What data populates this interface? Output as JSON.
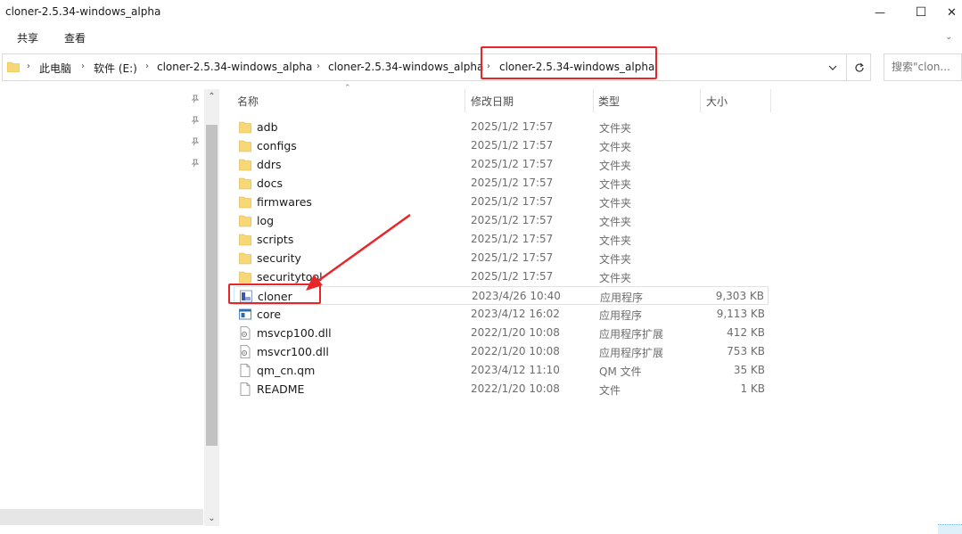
{
  "window": {
    "title": "cloner-2.5.34-windows_alpha",
    "minimize_glyph": "—",
    "maximize_glyph": "☐",
    "close_glyph": "✕"
  },
  "ribbon": {
    "tabs": [
      "共享",
      "查看"
    ]
  },
  "address": {
    "breadcrumbs": [
      "此电脑",
      "软件 (E:)",
      "cloner-2.5.34-windows_alpha",
      "cloner-2.5.34-windows_alpha",
      "cloner-2.5.34-windows_alpha"
    ]
  },
  "search": {
    "placeholder": "搜索\"clon..."
  },
  "columns": {
    "name": "名称",
    "date": "修改日期",
    "type": "类型",
    "size": "大小"
  },
  "files": [
    {
      "name": "adb",
      "date": "2025/1/2 17:57",
      "type": "文件夹",
      "size": "",
      "icon": "folder-icon"
    },
    {
      "name": "configs",
      "date": "2025/1/2 17:57",
      "type": "文件夹",
      "size": "",
      "icon": "folder-icon"
    },
    {
      "name": "ddrs",
      "date": "2025/1/2 17:57",
      "type": "文件夹",
      "size": "",
      "icon": "folder-icon"
    },
    {
      "name": "docs",
      "date": "2025/1/2 17:57",
      "type": "文件夹",
      "size": "",
      "icon": "folder-icon"
    },
    {
      "name": "firmwares",
      "date": "2025/1/2 17:57",
      "type": "文件夹",
      "size": "",
      "icon": "folder-icon"
    },
    {
      "name": "log",
      "date": "2025/1/2 17:57",
      "type": "文件夹",
      "size": "",
      "icon": "folder-icon"
    },
    {
      "name": "scripts",
      "date": "2025/1/2 17:57",
      "type": "文件夹",
      "size": "",
      "icon": "folder-icon"
    },
    {
      "name": "security",
      "date": "2025/1/2 17:57",
      "type": "文件夹",
      "size": "",
      "icon": "folder-icon"
    },
    {
      "name": "securitytool",
      "date": "2025/1/2 17:57",
      "type": "文件夹",
      "size": "",
      "icon": "folder-icon"
    },
    {
      "name": "cloner",
      "date": "2023/4/26 10:40",
      "type": "应用程序",
      "size": "9,303 KB",
      "icon": "app-icon",
      "selected": true
    },
    {
      "name": "core",
      "date": "2023/4/12 16:02",
      "type": "应用程序",
      "size": "9,113 KB",
      "icon": "window-app-icon"
    },
    {
      "name": "msvcp100.dll",
      "date": "2022/1/20 10:08",
      "type": "应用程序扩展",
      "size": "412 KB",
      "icon": "dll-icon"
    },
    {
      "name": "msvcr100.dll",
      "date": "2022/1/20 10:08",
      "type": "应用程序扩展",
      "size": "753 KB",
      "icon": "dll-icon"
    },
    {
      "name": "qm_cn.qm",
      "date": "2023/4/12 11:10",
      "type": "QM 文件",
      "size": "35 KB",
      "icon": "file-icon"
    },
    {
      "name": "README",
      "date": "2022/1/20 10:08",
      "type": "文件",
      "size": "1 KB",
      "icon": "file-icon"
    }
  ],
  "colors": {
    "annotation_red": "#e8262a",
    "folder_yellow": "#f8d775",
    "selection_border": "#cce8ff"
  }
}
